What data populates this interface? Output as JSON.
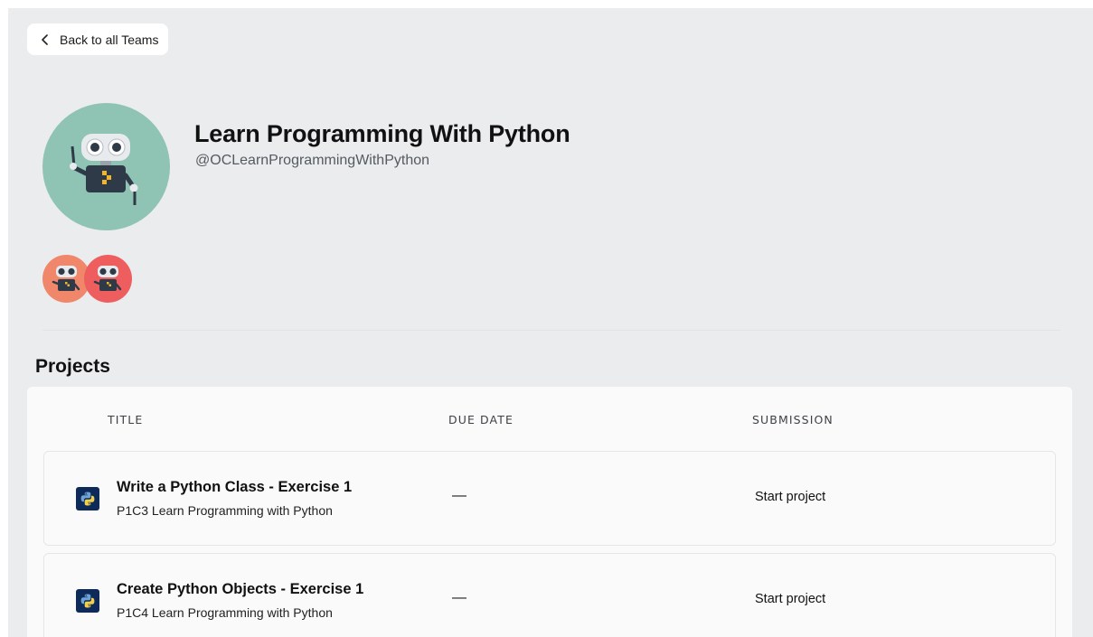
{
  "nav": {
    "back_label": "Back to all Teams",
    "back_icon": "chevron-left-icon"
  },
  "team": {
    "name": "Learn Programming With Python",
    "handle": "@OCLearnProgrammingWithPython",
    "avatar_color": "#8fc3b3"
  },
  "members": [
    {
      "avatar_color": "#f0876a"
    },
    {
      "avatar_color": "#ee5e5e"
    }
  ],
  "projects": {
    "heading": "Projects",
    "columns": {
      "title": "TITLE",
      "due_date": "DUE DATE",
      "submission": "SUBMISSION"
    },
    "rows": [
      {
        "title": "Write a Python Class - Exercise 1",
        "course": "P1C3 Learn Programming with Python",
        "due_date": "—",
        "action": "Start project",
        "icon": "python-icon"
      },
      {
        "title": "Create Python Objects - Exercise 1",
        "course": "P1C4 Learn Programming with Python",
        "due_date": "—",
        "action": "Start project",
        "icon": "python-icon"
      }
    ]
  },
  "colors": {
    "page_background": "#ebecee",
    "panel_background": "#fafafa",
    "python_icon_background": "#0e2a59"
  }
}
